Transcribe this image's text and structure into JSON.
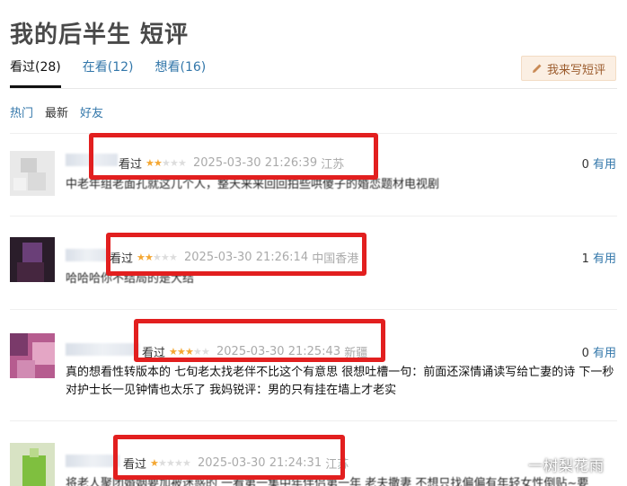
{
  "page": {
    "title": "我的后半生 短评"
  },
  "tabs": [
    {
      "label": "看过(28)",
      "active": true
    },
    {
      "label": "在看(12)",
      "active": false
    },
    {
      "label": "想看(16)",
      "active": false
    }
  ],
  "write_button": {
    "label": "我来写短评",
    "icon": "pencil-icon"
  },
  "filters": [
    {
      "label": "热门"
    },
    {
      "label": "最新"
    },
    {
      "label": "好友"
    }
  ],
  "reviews": [
    {
      "status": "看过",
      "stars": 2,
      "time": "2025-03-30 21:26:39",
      "location": "江苏",
      "useful_count": "0",
      "useful_label": "有用",
      "content": "中老年组老面孔就这几个人，整天来来回回拍些哄傻子的婚恋题材电视剧"
    },
    {
      "status": "看过",
      "stars": 2,
      "time": "2025-03-30 21:26:14",
      "location": "中国香港",
      "useful_count": "1",
      "useful_label": "有用",
      "content": "哈哈哈你不结局的是大结"
    },
    {
      "status": "看过",
      "stars": 3,
      "time": "2025-03-30 21:25:43",
      "location": "新疆",
      "useful_count": "0",
      "useful_label": "有用",
      "content": "真的想看性转版本的 七旬老太找老伴不比这个有意思 很想吐槽一句：前面还深情诵读写给亡妻的诗 下一秒对护士长一见钟情也太乐了 我妈锐评：男的只有挂在墙上才老实"
    },
    {
      "status": "看过",
      "stars": 1,
      "time": "2025-03-30 21:24:31",
      "location": "江苏",
      "useful_count": "",
      "useful_label": "",
      "content": "将老人聚团婚姻要加被迷惑的 一看第一集中年伴侣第一年 老夫撒妻 不想只找偏偏有年轻女性倒贴~要"
    }
  ],
  "watermark": "一树梨花雨"
}
